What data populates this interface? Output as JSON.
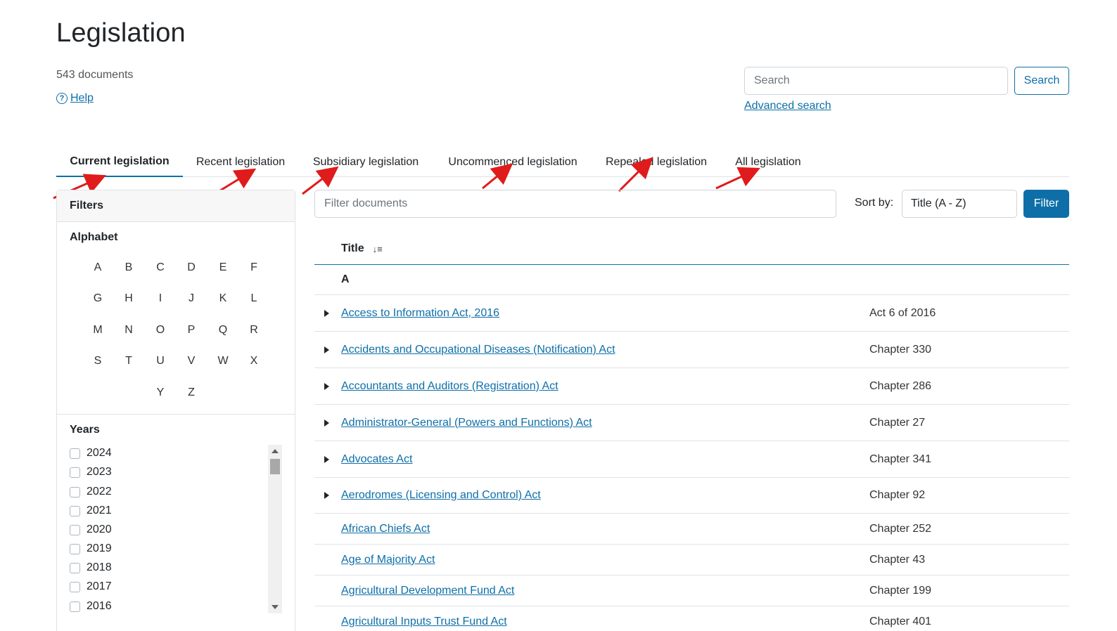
{
  "header": {
    "title": "Legislation",
    "doc_count": "543 documents",
    "help_label": "Help"
  },
  "search": {
    "placeholder": "Search",
    "button_label": "Search",
    "advanced_label": "Advanced search"
  },
  "tabs": [
    {
      "label": "Current legislation",
      "active": true
    },
    {
      "label": "Recent legislation",
      "active": false
    },
    {
      "label": "Subsidiary legislation",
      "active": false
    },
    {
      "label": "Uncommenced legislation",
      "active": false
    },
    {
      "label": "Repealed legislation",
      "active": false
    },
    {
      "label": "All legislation",
      "active": false
    }
  ],
  "filters": {
    "heading": "Filters",
    "alphabet_title": "Alphabet",
    "letters": [
      "A",
      "B",
      "C",
      "D",
      "E",
      "F",
      "G",
      "H",
      "I",
      "J",
      "K",
      "L",
      "M",
      "N",
      "O",
      "P",
      "Q",
      "R",
      "S",
      "T",
      "U",
      "V",
      "W",
      "X",
      "Y",
      "Z"
    ],
    "years_title": "Years",
    "years": [
      "2024",
      "2023",
      "2022",
      "2021",
      "2020",
      "2019",
      "2018",
      "2017",
      "2016"
    ]
  },
  "toolbar": {
    "filter_placeholder": "Filter documents",
    "sort_label": "Sort by:",
    "sort_value": "Title (A - Z)",
    "filter_button": "Filter"
  },
  "table": {
    "header_title": "Title",
    "group_letter": "A",
    "rows": [
      {
        "title": "Access to Information Act, 2016",
        "number": "Act 6 of 2016",
        "expandable": true
      },
      {
        "title": "Accidents and Occupational Diseases (Notification) Act",
        "number": "Chapter 330",
        "expandable": true
      },
      {
        "title": "Accountants and Auditors (Registration) Act",
        "number": "Chapter 286",
        "expandable": true
      },
      {
        "title": "Administrator-General (Powers and Functions) Act",
        "number": "Chapter 27",
        "expandable": true
      },
      {
        "title": "Advocates Act",
        "number": "Chapter 341",
        "expandable": true
      },
      {
        "title": "Aerodromes (Licensing and Control) Act",
        "number": "Chapter 92",
        "expandable": true
      },
      {
        "title": "African Chiefs Act",
        "number": "Chapter 252",
        "expandable": false
      },
      {
        "title": "Age of Majority Act",
        "number": "Chapter 43",
        "expandable": false
      },
      {
        "title": "Agricultural Development Fund Act",
        "number": "Chapter 199",
        "expandable": false
      },
      {
        "title": "Agricultural Inputs Trust Fund Act",
        "number": "Chapter 401",
        "expandable": false
      }
    ]
  },
  "colors": {
    "accent": "#0e6fa8",
    "annotation_arrow": "#e01b1b"
  }
}
